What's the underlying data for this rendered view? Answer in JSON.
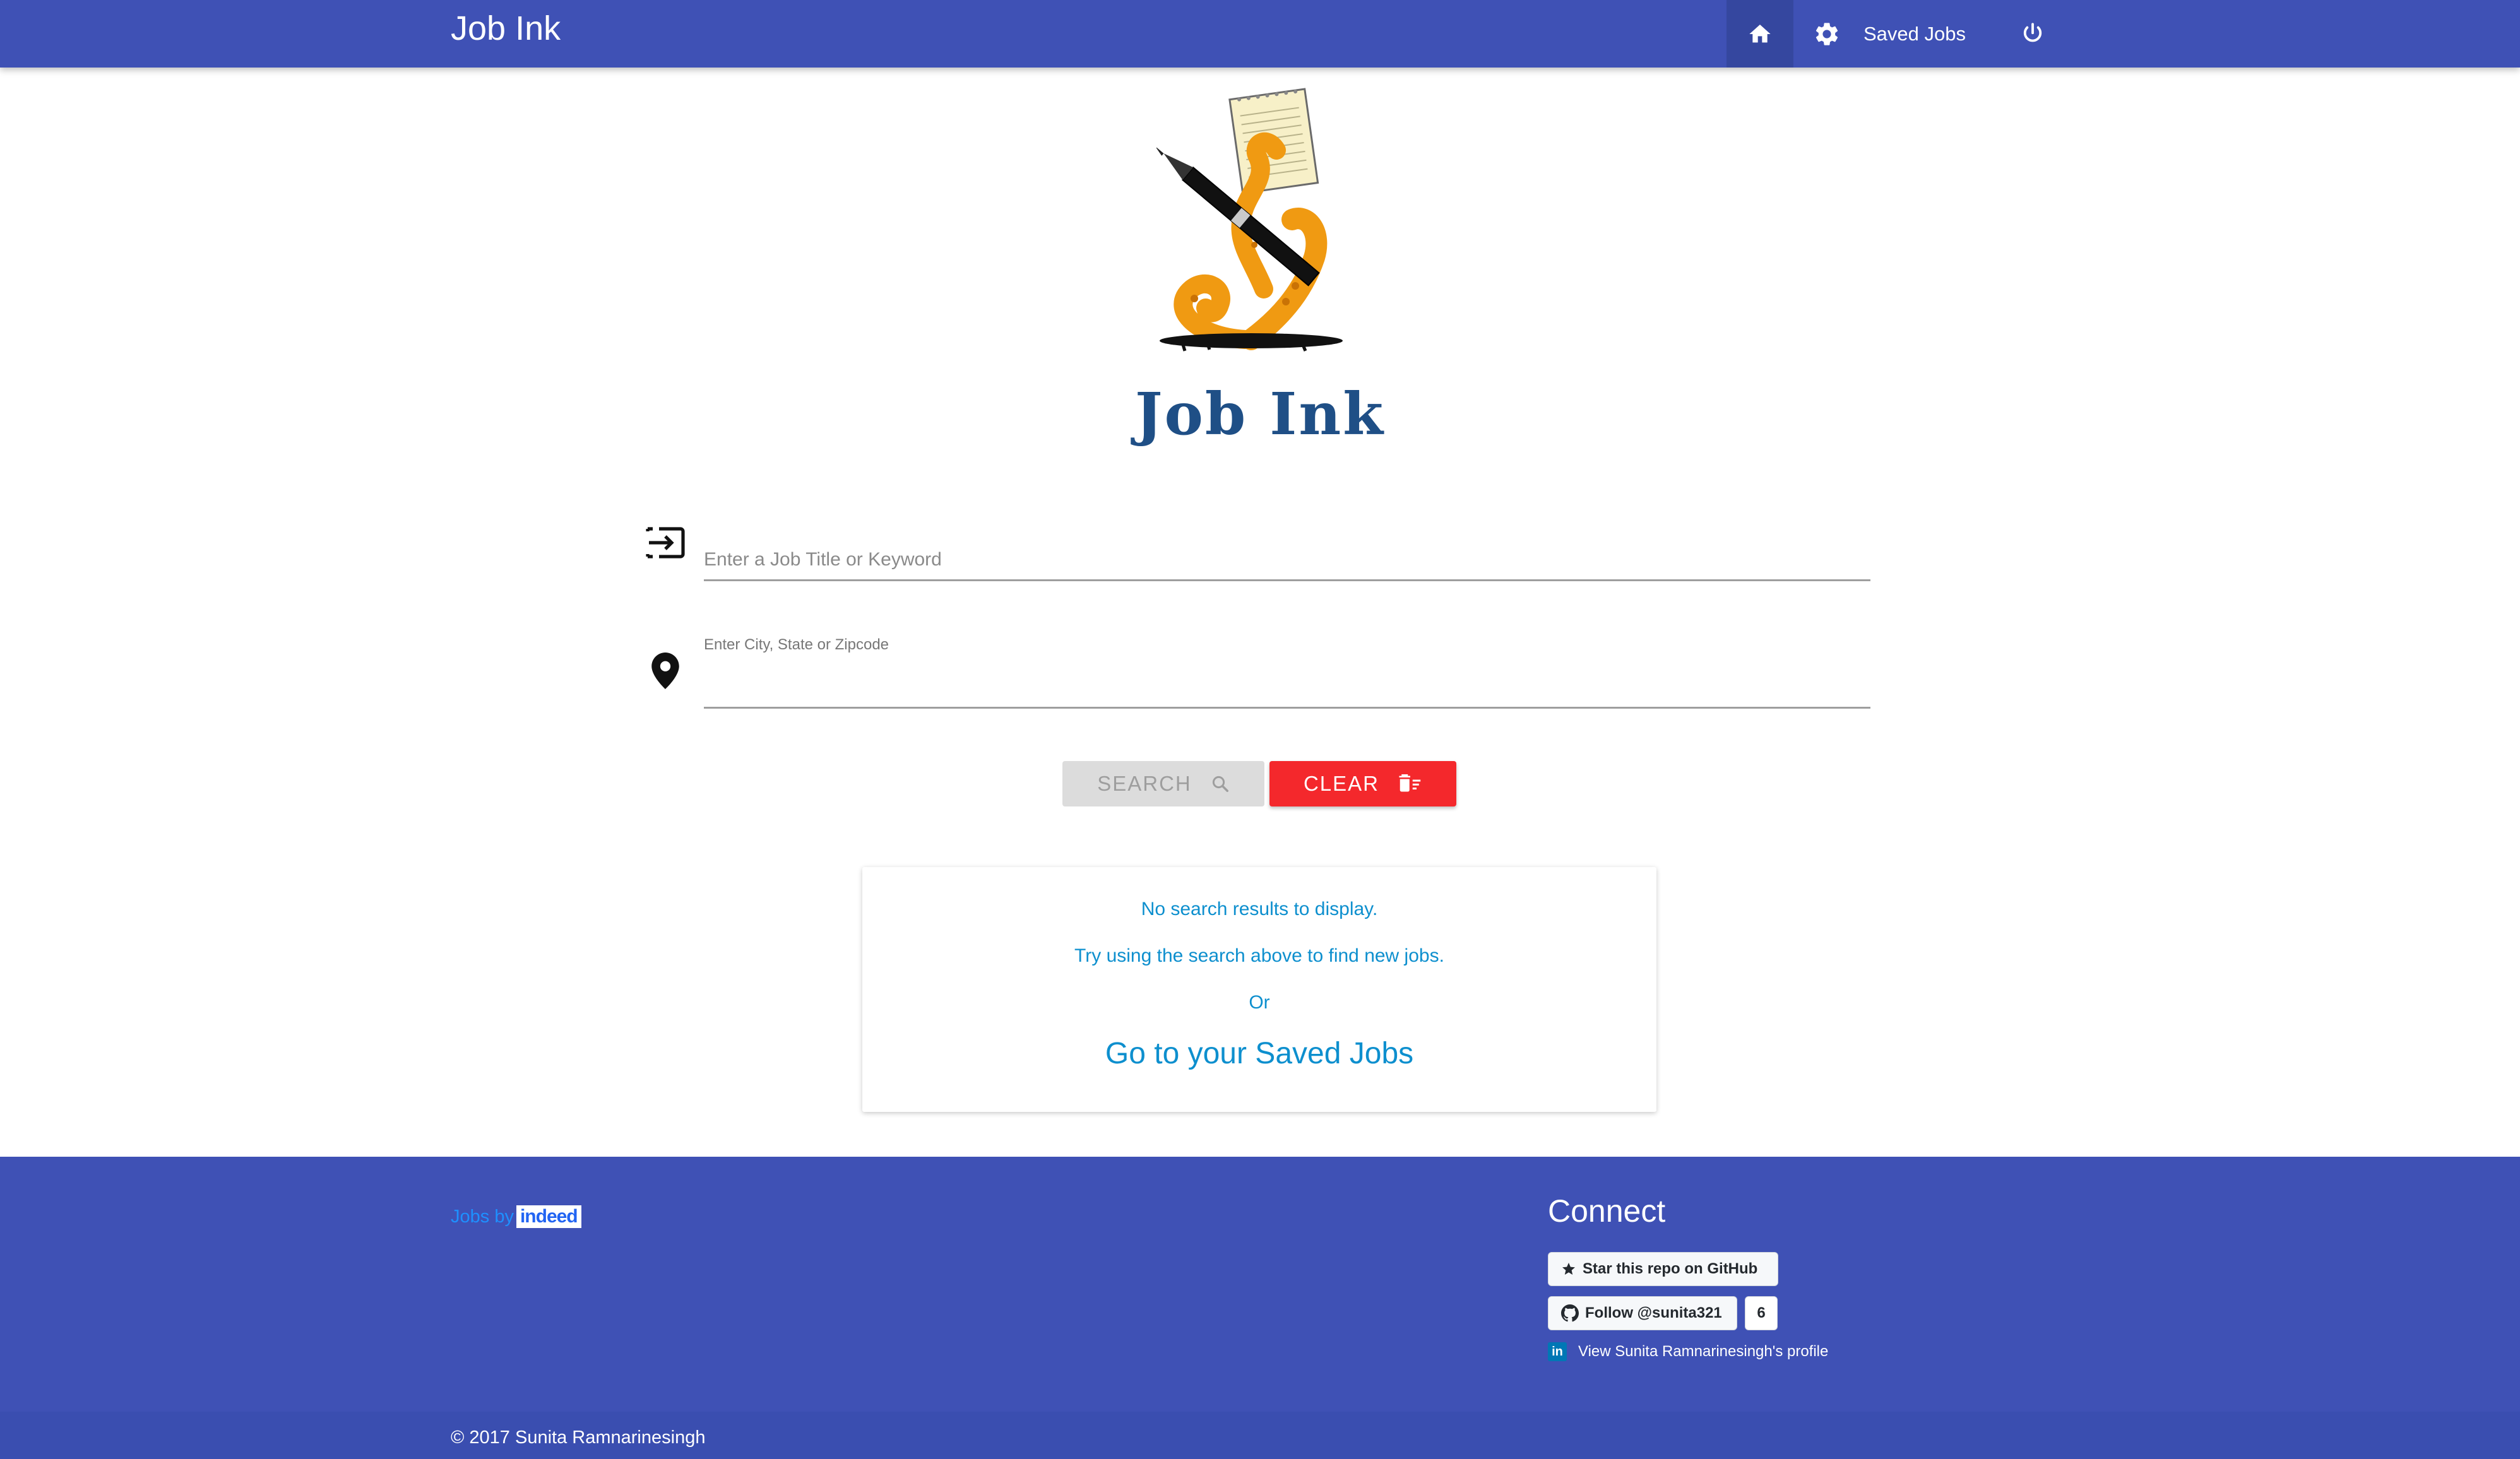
{
  "navbar": {
    "brand": "Job Ink",
    "saved_jobs_label": "Saved Jobs",
    "items": [
      "home-icon",
      "gear-icon",
      "Saved Jobs",
      "power-icon"
    ]
  },
  "hero": {
    "title": "Job Ink"
  },
  "search": {
    "keyword_placeholder": "Enter a Job Title or Keyword",
    "keyword_value": "",
    "location_label": "Enter City, State or Zipcode",
    "location_value": ""
  },
  "buttons": {
    "search_label": "SEARCH",
    "clear_label": "CLEAR"
  },
  "results": {
    "line1": "No search results to display.",
    "line2": "Try using the search above to find new jobs.",
    "line3": "Or",
    "link": "Go to your Saved Jobs"
  },
  "footer": {
    "jobs_by": "Jobs by",
    "indeed": "indeed",
    "connect_title": "Connect",
    "github_star": "Star this repo on GitHub",
    "github_follow": "Follow @sunita321",
    "github_follow_count": "6",
    "linkedin_icon": "in",
    "linkedin_text": "View Sunita Ramnarinesingh's profile",
    "copyright": "© 2017 Sunita Ramnarinesingh"
  },
  "colors": {
    "primary": "#3f51b5",
    "clear_button": "#f4282c",
    "link": "#0d8fce",
    "hero_title": "#1f4f86"
  }
}
